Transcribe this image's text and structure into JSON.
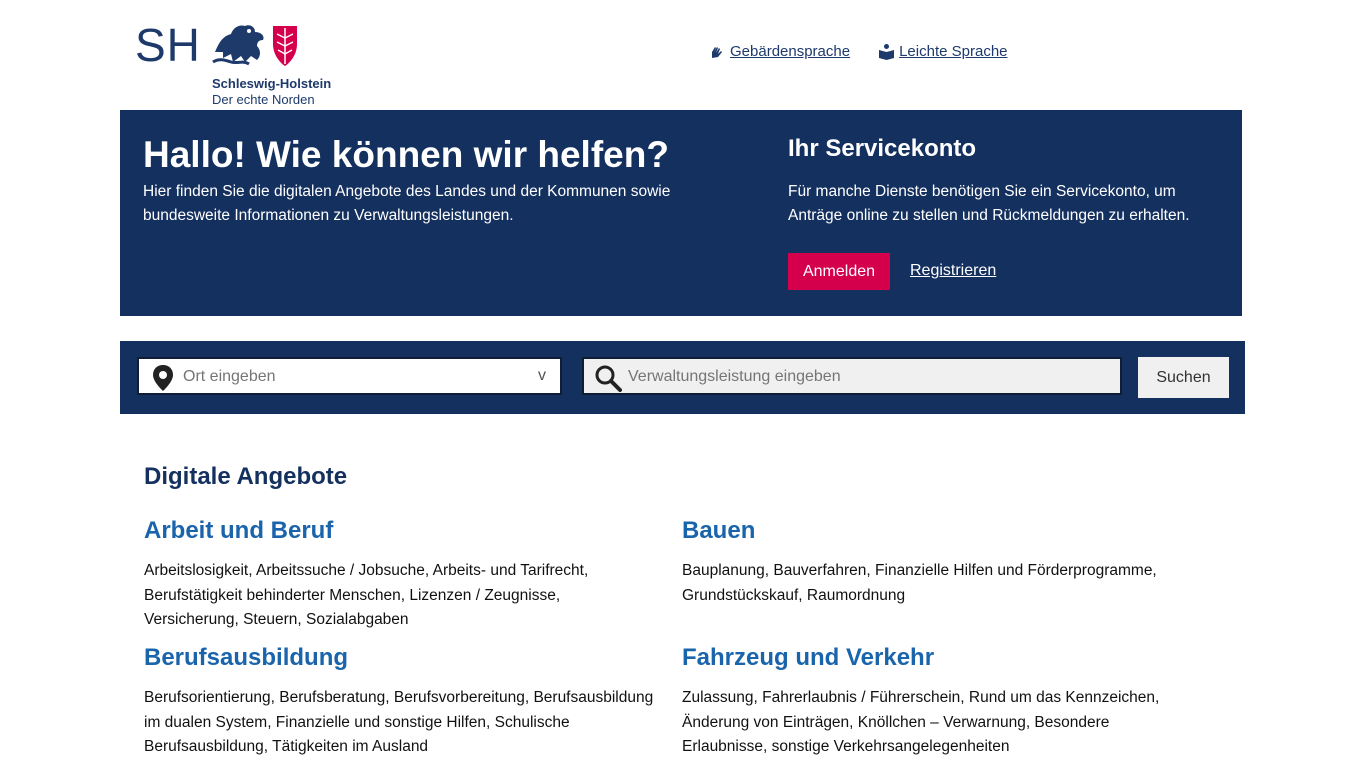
{
  "logo": {
    "letters": "SH",
    "name": "Schleswig-Holstein",
    "tagline": "Der echte Norden"
  },
  "toplinks": [
    {
      "label": "Gebärdensprache",
      "icon": "sign-language-icon"
    },
    {
      "label": "Leichte Sprache",
      "icon": "easy-language-icon"
    }
  ],
  "hero": {
    "title": "Hallo! Wie können wir helfen?",
    "text": "Hier finden Sie die digitalen Angebote des Landes und der Kommunen sowie bundesweite Informationen zu Verwaltungsleistungen."
  },
  "servicekonto": {
    "title": "Ihr Servicekonto",
    "text": "Für manche Dienste benötigen Sie ein Servicekonto, um Anträge online zu stellen und Rückmeldungen zu erhalten.",
    "login_label": "Anmelden",
    "register_label": "Registrieren"
  },
  "search": {
    "location_placeholder": "Ort eingeben",
    "location_chevron": "v",
    "service_placeholder": "Verwaltungsleistung eingeben",
    "button_label": "Suchen"
  },
  "colors": {
    "navy": "#14305f",
    "accent": "#d4004c",
    "link_blue": "#1a64ac"
  },
  "main": {
    "title": "Digitale Angebote",
    "categories": [
      {
        "title": "Arbeit und Beruf",
        "text": "Arbeitslosigkeit, Arbeitssuche / Jobsuche, Arbeits- und Tarifrecht, Berufstätigkeit behinderter Menschen, Lizenzen / Zeugnisse, Versicherung, Steuern, Sozialabgaben"
      },
      {
        "title": "Bauen",
        "text": "Bauplanung, Bauverfahren, Finanzielle Hilfen und Förderprogramme, Grundstückskauf, Raumordnung"
      },
      {
        "title": "Berufsausbildung",
        "text": "Berufsorientierung, Berufsberatung, Berufsvorbereitung, Berufsausbildung im dualen System, Finanzielle und sonstige Hilfen, Schulische Berufsausbildung, Tätigkeiten im Ausland"
      },
      {
        "title": "Fahrzeug und Verkehr",
        "text": "Zulassung, Fahrerlaubnis / Führerschein, Rund um das Kennzeichen, Änderung von Einträgen, Knöllchen – Verwarnung, Besondere Erlaubnisse, sonstige Verkehrsangelegenheiten"
      }
    ]
  }
}
